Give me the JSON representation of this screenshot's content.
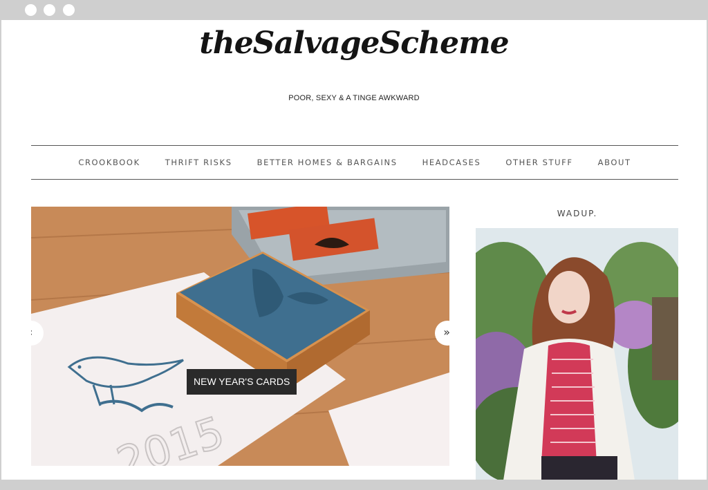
{
  "browser": {
    "dots": [
      "close",
      "minimize",
      "zoom"
    ]
  },
  "site": {
    "logo": "theSalvageScheme",
    "tagline": "POOR, SEXY & A TINGE AWKWARD"
  },
  "nav": {
    "items": [
      {
        "label": "CROOKBOOK"
      },
      {
        "label": "THRIFT RISKS"
      },
      {
        "label": "BETTER HOMES & BARGAINS"
      },
      {
        "label": "HEADCASES"
      },
      {
        "label": "OTHER STUFF"
      },
      {
        "label": "ABOUT"
      }
    ]
  },
  "slider": {
    "prev_label": "‹",
    "next_label": "»",
    "caption": "NEW YEAR'S CARDS",
    "stamp_year": "2015"
  },
  "sidebar": {
    "title": "WADUP."
  },
  "colors": {
    "background": "#ffffff",
    "chrome": "#cfcfcf",
    "nav_text": "#555555",
    "caption_bg": "#2a2a2a",
    "stamp_blue": "#3f6f8f"
  }
}
